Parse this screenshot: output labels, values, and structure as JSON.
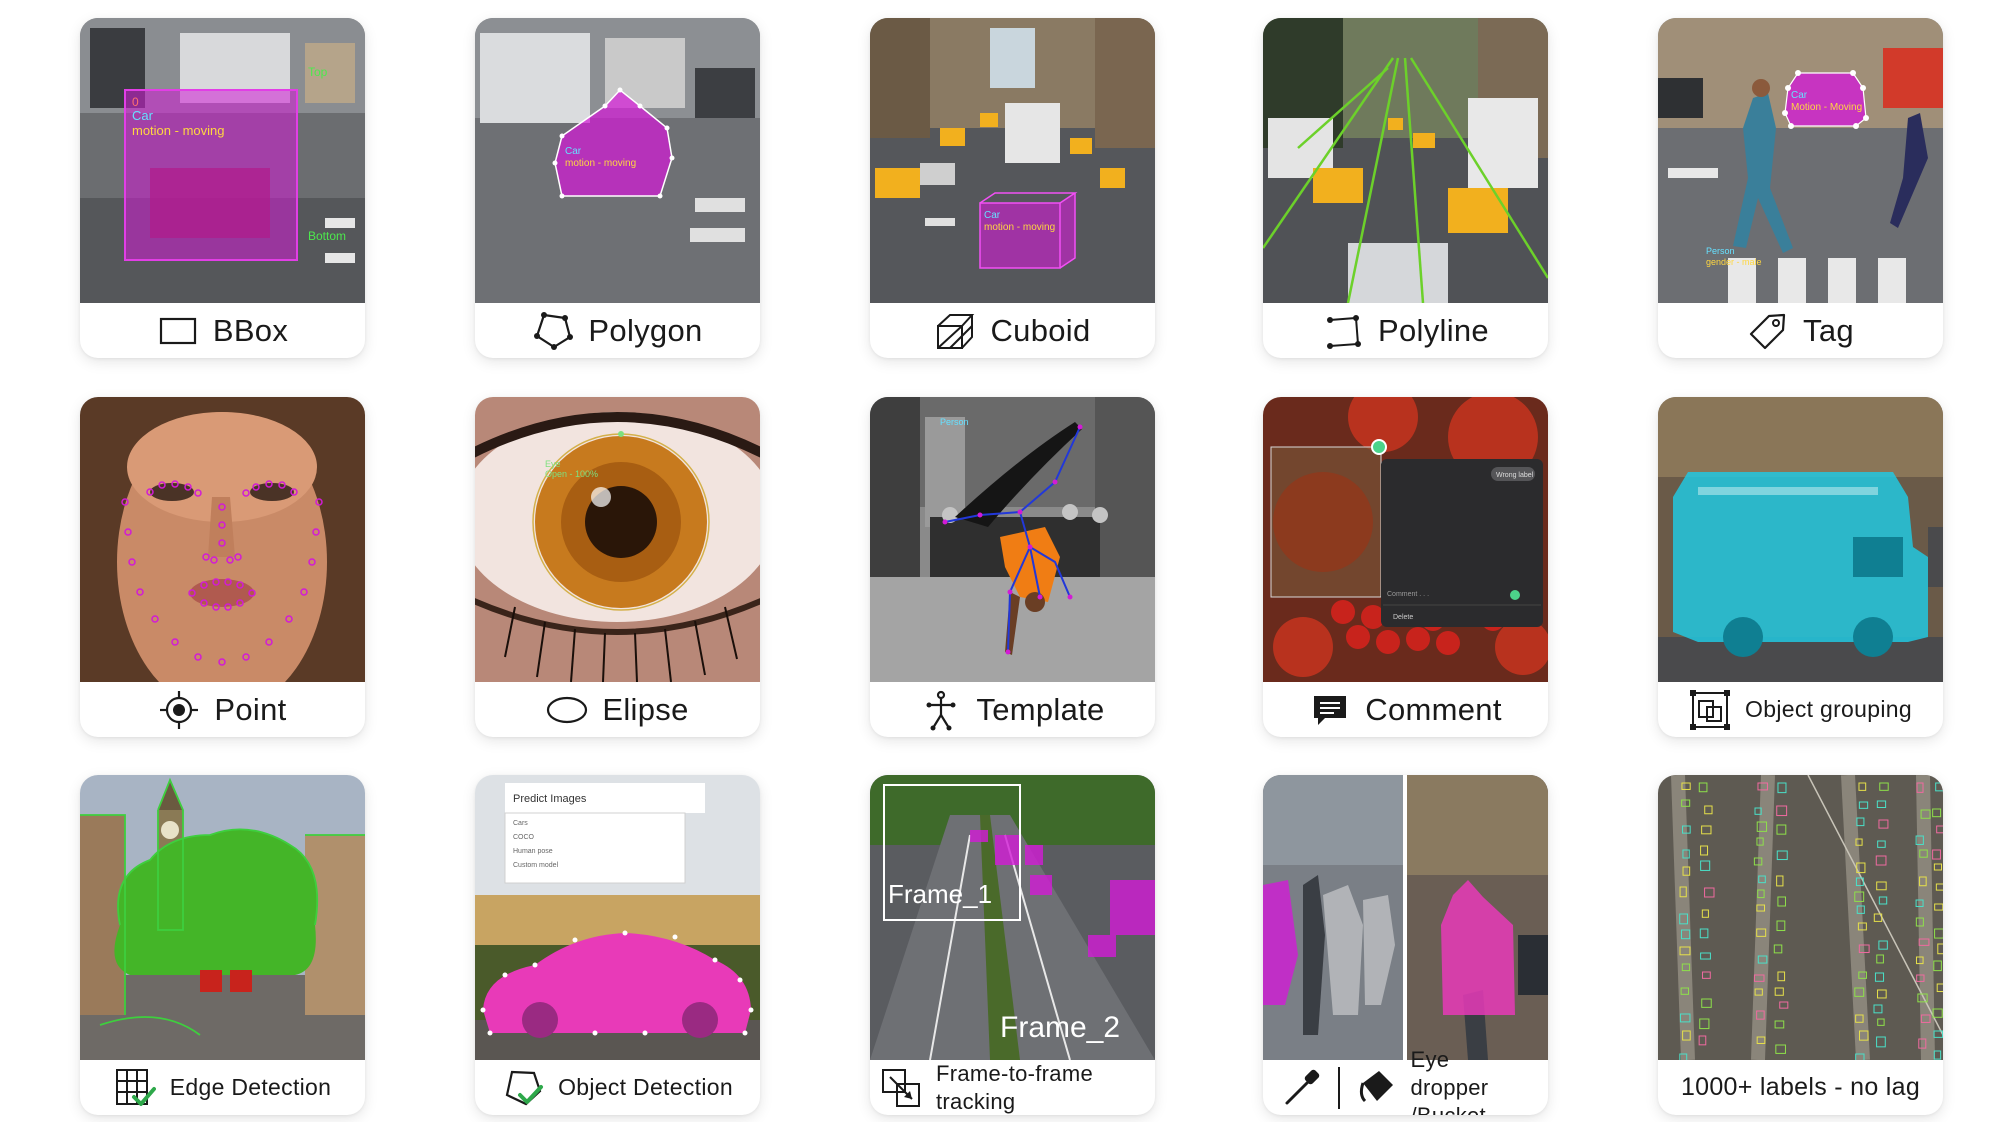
{
  "cards": [
    {
      "label": "BBox",
      "icon": "bbox-icon",
      "overlay": [
        "0",
        "Car",
        "motion - moving",
        "Top",
        "Bottom"
      ]
    },
    {
      "label": "Polygon",
      "icon": "polygon-icon",
      "overlay": [
        "Car",
        "motion - moving"
      ]
    },
    {
      "label": "Cuboid",
      "icon": "cuboid-icon",
      "overlay": [
        "Car",
        "motion - moving"
      ]
    },
    {
      "label": "Polyline",
      "icon": "polyline-icon",
      "overlay": []
    },
    {
      "label": "Tag",
      "icon": "tag-icon",
      "overlay": [
        "Car",
        "Motion - Moving",
        "Person",
        "gender - male"
      ]
    },
    {
      "label": "Point",
      "icon": "point-icon",
      "overlay": []
    },
    {
      "label": "Elipse",
      "icon": "ellipse-icon",
      "overlay": [
        "Eye",
        "Open - 100%"
      ]
    },
    {
      "label": "Template",
      "icon": "template-icon",
      "overlay": [
        "Person"
      ]
    },
    {
      "label": "Comment",
      "icon": "comment-icon",
      "overlay": [
        "Wrong label",
        "Comment . . .",
        "Delete"
      ]
    },
    {
      "label": "Object grouping",
      "icon": "object-grouping-icon",
      "overlay": []
    },
    {
      "label": "Edge Detection",
      "icon": "edge-detection-icon",
      "overlay": []
    },
    {
      "label": "Object Detection",
      "icon": "object-detection-icon",
      "overlay": [
        "Predict Images",
        "Cars",
        "COCO",
        "Human pose",
        "Custom model"
      ]
    },
    {
      "label": "Frame-to-frame tracking",
      "icon": "frame-tracking-icon",
      "overlay": [
        "Frame_1",
        "Frame_2"
      ]
    },
    {
      "label": "Eye dropper /Bucket",
      "icon": "eye-dropper-icon",
      "overlay": []
    },
    {
      "label": "1000+ labels - no lag",
      "icon": "",
      "overlay": []
    }
  ],
  "colors": {
    "magenta": "#d21bd6",
    "green": "#3ecf3e",
    "cyan": "#21c8e0",
    "orange": "#f08a1e"
  }
}
